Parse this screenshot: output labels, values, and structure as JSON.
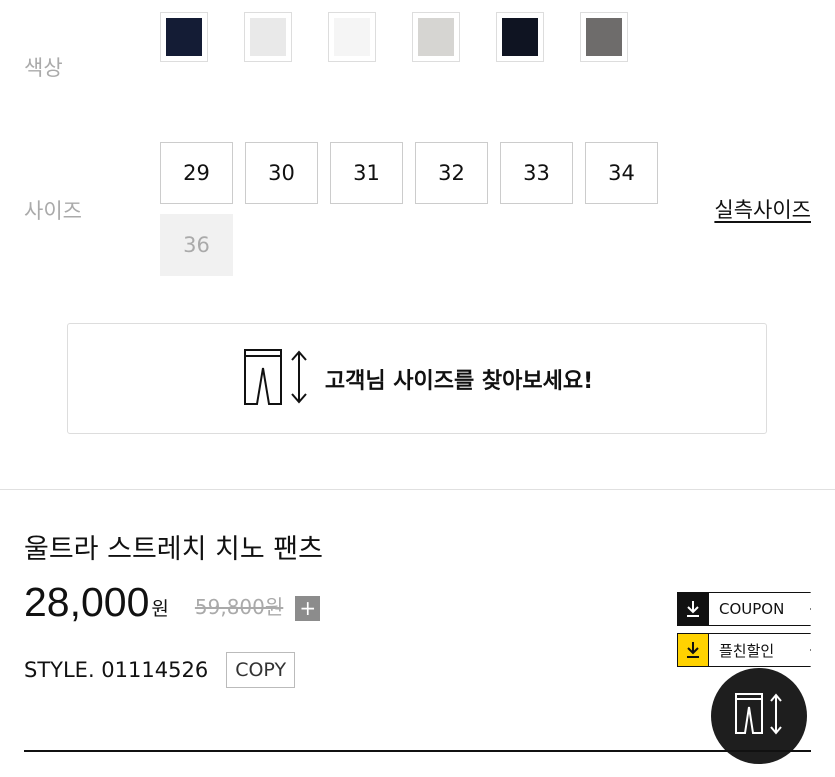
{
  "options": {
    "color_label": "색상",
    "size_label": "사이즈",
    "swatches": [
      {
        "name": "navy",
        "hex": "#141c35"
      },
      {
        "name": "light-gray",
        "hex": "#e9e9e9"
      },
      {
        "name": "white",
        "hex": "#f5f5f5"
      },
      {
        "name": "stone",
        "hex": "#d6d5d2"
      },
      {
        "name": "dark-navy",
        "hex": "#0f1422"
      },
      {
        "name": "charcoal",
        "hex": "#6e6c6b"
      }
    ],
    "sizes": [
      {
        "label": "29",
        "available": true
      },
      {
        "label": "30",
        "available": true
      },
      {
        "label": "31",
        "available": true
      },
      {
        "label": "32",
        "available": true
      },
      {
        "label": "33",
        "available": true
      },
      {
        "label": "34",
        "available": true
      },
      {
        "label": "36",
        "available": false
      }
    ],
    "size_guide_link": "실측사이즈"
  },
  "size_finder": {
    "text": "고객님 사이즈를 찾아보세요!",
    "icon": "pants-ruler-icon"
  },
  "product": {
    "name": "울트라 스트레치 치노 팬츠",
    "price": "28,000",
    "price_unit": "원",
    "original_price": "59,800원",
    "plus_label": "+",
    "style_label": "STYLE. 01114526",
    "copy_label": "COPY"
  },
  "coupons": [
    {
      "label": "COUPON",
      "icon": "download-icon",
      "accent": "#111111"
    },
    {
      "label": "플친할인",
      "icon": "download-icon",
      "accent": "#ffd200"
    }
  ],
  "fab": {
    "icon": "pants-ruler-icon"
  }
}
